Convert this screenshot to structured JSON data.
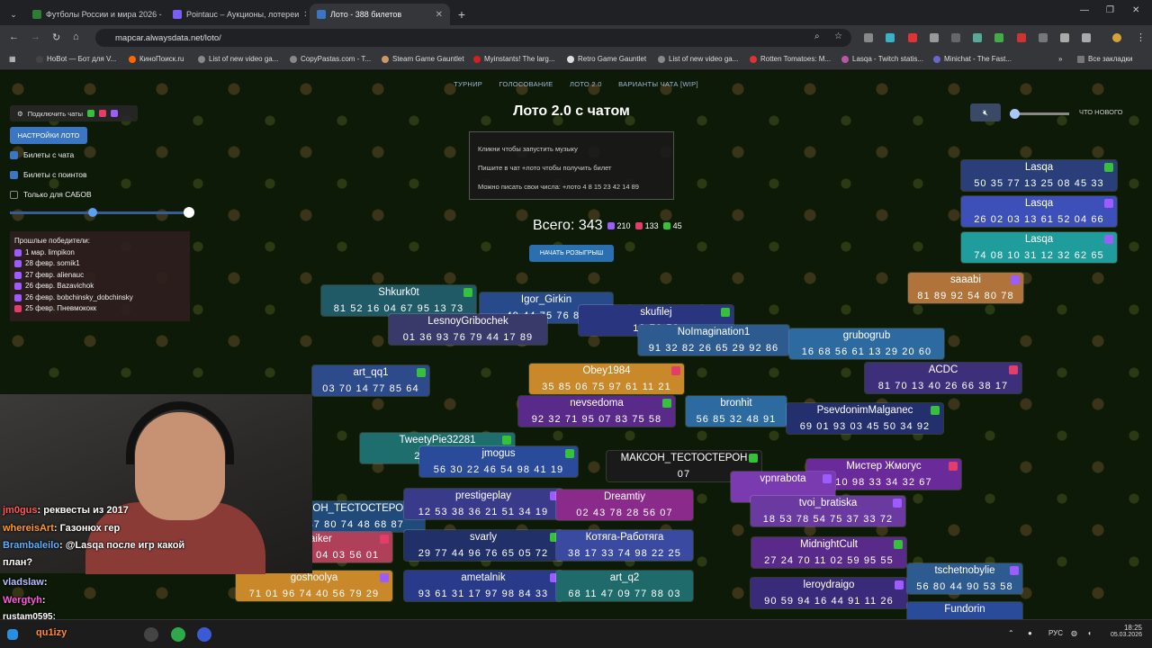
{
  "browser": {
    "tabs": [
      {
        "label": "Футболы России и мира 2026 -",
        "color": "#2e7d32"
      },
      {
        "label": "Pointauc – Аукционы, лотереи",
        "color": "#7b5cff"
      },
      {
        "label": "Лото - 388 билетов",
        "color": "#3b76c5"
      }
    ],
    "url": "mapcar.alwaysdata.net/loto/",
    "bookmarks": [
      "HoBot — Бот для V...",
      "КиноПоиск.ru",
      "List of new video ga...",
      "CopyPastas.com - T...",
      "Steam Game Gauntlet",
      "Myinstants! The larg...",
      "Retro Game Gauntlet",
      "List of new video ga...",
      "Rotten Tomatoes: M...",
      "Lasqa - Twitch statis...",
      "Minichat - The Fast..."
    ],
    "all_bookmarks": "Все закладки"
  },
  "page": {
    "nav": [
      "ТУРНИР",
      "ГОЛОСОВАНИЕ",
      "ЛОТО 2.0",
      "ВАРИАНТЫ ЧАТА [WIP]"
    ],
    "title": "Лото 2.0 с чатом",
    "hint": [
      "Кликни чтобы запустить музыку",
      "Пишите в чат +лото чтобы получить билет",
      "Можно писать свои числа: +лото 4 8 15 23 42 14 89"
    ],
    "total_label": "Всего: 343",
    "counts": {
      "twitch": "210",
      "youtube": "133",
      "kick": "45"
    },
    "draw_button": "НАЧАТЬ РОЗЫГРЫШ",
    "connect_chats": "Подключить чаты",
    "loto_settings": "НАСТРОЙКИ ЛОТО",
    "opt_chat": "Билеты с чата",
    "opt_points": "Билеты с поинтов",
    "opt_subs": "Только для САБОВ",
    "winners_title": "Прошлые победители:",
    "winners": [
      "1 мар. limpikon",
      "28 февр. somik1",
      "27 февр. alienauc",
      "26 февр. Bazavichok",
      "26 февр. bobchinsky_dobchinsky",
      "25 февр. Пневмококк"
    ],
    "whats_new": "ЧТО НОВОГО"
  },
  "tickets": [
    {
      "name": "Lasqa",
      "nums": "50 35 77 13 25 08 45 33",
      "bg": "#2a3f7a",
      "badge": "#35c23a"
    },
    {
      "name": "Lasqa",
      "nums": "26 02 03 13 61 52 04 66",
      "bg": "#3d4fb8",
      "badge": "#9c5cff"
    },
    {
      "name": "Lasqa",
      "nums": "74 08 10 31 12 32 62 65",
      "bg": "#1f9c9c",
      "badge": "#9c5cff"
    },
    {
      "name": "Shkurk0t",
      "nums": "81 52 16 04 67 95 13 73",
      "bg": "#1f5a66",
      "badge": "#35c23a"
    },
    {
      "name": "Igor_Girkin",
      "nums": "49 44 75 76 84",
      "bg": "#264a8a",
      "badge": ""
    },
    {
      "name": "skufilej",
      "nums": "19 70 58",
      "bg": "#2a3580",
      "badge": "#35c23a"
    },
    {
      "name": "NoImagination1",
      "nums": "91 32 82 26 65 29 92 86",
      "bg": "#2d5b8f",
      "badge": ""
    },
    {
      "name": "grubogrub",
      "nums": "16 68 56 61 13 29 20 60",
      "bg": "#2d6aa0",
      "badge": ""
    },
    {
      "name": "ACDC",
      "nums": "81 70 13 40 26 66 38 17",
      "bg": "#3d2f7a",
      "badge": "#e23d6b"
    },
    {
      "name": "saaabi",
      "nums": "81 89 92 54 80 78",
      "bg": "#b0743a",
      "badge": "#9c5cff"
    },
    {
      "name": "LesnoyGribochek",
      "nums": "01 36 93 76 79 44 17 89",
      "bg": "#3a3a6a",
      "badge": ""
    },
    {
      "name": "art_qq1",
      "nums": "03 70 14 77 85 64",
      "bg": "#2d4a8a",
      "badge": "#35c23a"
    },
    {
      "name": "Obey1984",
      "nums": "35 85 06 75 97 61 11 21",
      "bg": "#c9882a",
      "badge": "#e23d6b"
    },
    {
      "name": "nevsedoma",
      "nums": "92 32 71 95 07 83 75 58",
      "bg": "#5a2a8a",
      "badge": "#35c23a"
    },
    {
      "name": "bronhit",
      "nums": "56 85 32 48 91",
      "bg": "#2d6aa0",
      "badge": ""
    },
    {
      "name": "PsevdonimMalganec",
      "nums": "69 01 93 03 45 50 34 92",
      "bg": "#24306e",
      "badge": "#35c23a"
    },
    {
      "name": "TweetyPie32281",
      "nums": "28 98 17",
      "bg": "#1f6e6e",
      "badge": "#35c23a"
    },
    {
      "name": "jmogus",
      "nums": "56 30 22 46 54 98 41 19",
      "bg": "#2a4a9a",
      "badge": "#35c23a"
    },
    {
      "name": "МАКСОН_ТЕСТОСТЕРОН",
      "nums": "07",
      "bg": "#1a1a1a",
      "badge": "#35c23a"
    },
    {
      "name": "Мистер Жмогус",
      "nums": "10 98 33 34 32 67",
      "bg": "#6a2a9a",
      "badge": "#e23d6b"
    },
    {
      "name": "vpnrabota",
      "nums": "",
      "bg": "#7a3ab0",
      "badge": "#9c5cff"
    },
    {
      "name": "МАКСОН_ТЕСТОСТЕРОН",
      "nums": "33 87 80 74 48 68 87",
      "bg": "#1f4a7a",
      "badge": ""
    },
    {
      "name": "prestigeplay",
      "nums": "12 53 38 36 21 51 34 19",
      "bg": "#3a3a8a",
      "badge": "#9c5cff"
    },
    {
      "name": "Dreamtiy",
      "nums": "02 43 78 28 56 07",
      "bg": "#8a2a8a",
      "badge": ""
    },
    {
      "name": "tvoi_bratiska",
      "nums": "18 53 78 54 75 37 33 72",
      "bg": "#6a3aa0",
      "badge": "#9c5cff"
    },
    {
      "name": "svarly",
      "nums": "29 77 44 96 76 65 05 72",
      "bg": "#22306a",
      "badge": "#35c23a"
    },
    {
      "name": "Котяга-Работяга",
      "nums": "38 17 33 74 98 22 25",
      "bg": "#3a4aa0",
      "badge": ""
    },
    {
      "name": "MidnightCult",
      "nums": "27 24 70 11 02 59 95 55",
      "bg": "#5a2a8a",
      "badge": "#35c23a"
    },
    {
      "name": "Straiker",
      "nums": "15 21 57 25 04 03 56 01",
      "bg": "#b0405a",
      "badge": "#e23d6b"
    },
    {
      "name": "goshoolya",
      "nums": "71 01 96 74 40 56 79 29",
      "bg": "#c9882a",
      "badge": "#9c5cff"
    },
    {
      "name": "ametalnik",
      "nums": "93 61 31 17 97 98 84 33",
      "bg": "#2a3a8a",
      "badge": "#9c5cff"
    },
    {
      "name": "art_q2",
      "nums": "68 11 47 09 77 88 03",
      "bg": "#1f6a6a",
      "badge": ""
    },
    {
      "name": "leroydraigo",
      "nums": "90 59 94 16 44 91 11 26",
      "bg": "#3a2a7a",
      "badge": "#9c5cff"
    },
    {
      "name": "tschetnobylie",
      "nums": "56 80 44 90 53 58",
      "bg": "#2d5a8f",
      "badge": "#9c5cff"
    },
    {
      "name": "Fundorin",
      "nums": "",
      "bg": "#2a4a9a",
      "badge": ""
    }
  ],
  "chat": [
    {
      "user": "jm0gus",
      "msg": ": реквесты из 2017",
      "color": "#ff5a5a"
    },
    {
      "user": "whereisArt",
      "msg": ": Газонюх гер",
      "color": "#ff9a3a"
    },
    {
      "user": "Brambaleilo",
      "msg": ": @Lasqa после игр какой",
      "color": "#5ab0ff"
    },
    {
      "user": "",
      "msg": "план?",
      "color": "#ffffff"
    },
    {
      "user": "vladslaw",
      "msg": ":",
      "color": "#bbbbff"
    },
    {
      "user": "Wergtyh",
      "msg": ":",
      "color": "#ff5ae0"
    },
    {
      "user": "rustam0595",
      "msg": ":",
      "color": "#ffffff"
    },
    {
      "user": "qu1izy",
      "msg": ":",
      "color": "#ff8a3a"
    }
  ],
  "taskbar": {
    "lang": "РУС",
    "time": "18:25",
    "date": "05.03.2026"
  }
}
